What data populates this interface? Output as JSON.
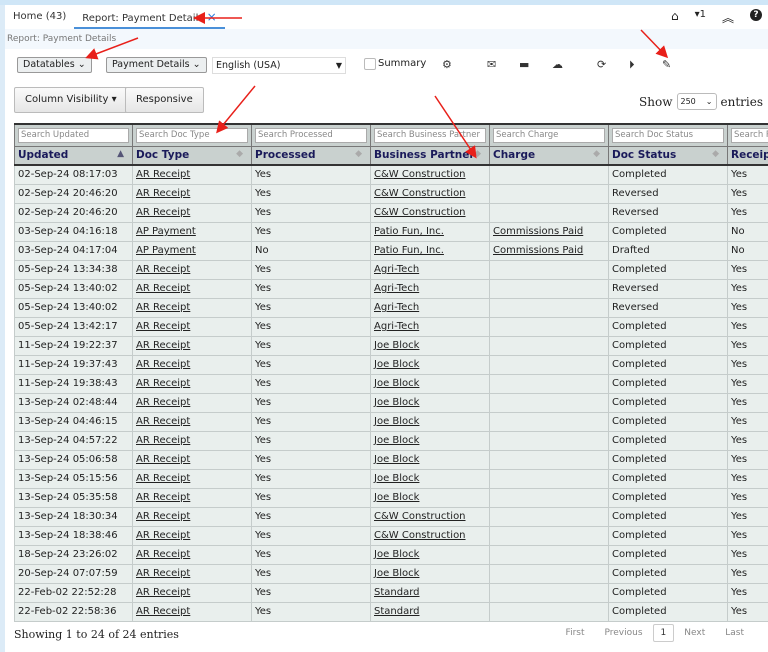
{
  "tabs": [
    {
      "label": "Home (43)"
    },
    {
      "label": "Report: Payment Details",
      "close": "×"
    }
  ],
  "topbar": {
    "icons": [
      "home-icon",
      "caret-down-icon",
      "chevrons-up-icon",
      "help-icon"
    ],
    "notify_count": "1"
  },
  "breadcrumb": "Report: Payment Details",
  "toolbar": {
    "datatables": "Datatables",
    "report": "Payment Details",
    "language": "English (USA)",
    "summary_label": "Summary",
    "summary_checked": false,
    "icons": [
      "gears-icon",
      "envelope-icon",
      "archive-icon",
      "cloud-download-icon",
      "refresh-icon",
      "play-icon",
      "pencil-icon"
    ]
  },
  "buttons": {
    "column_visibility": "Column Visibility",
    "responsive": "Responsive"
  },
  "show": {
    "prefix": "Show",
    "value": "250",
    "suffix": "entries"
  },
  "table": {
    "search_placeholders": [
      "Search Updated",
      "Search Doc Type",
      "Search Processed",
      "Search Business Partner",
      "Search Charge",
      "Search Doc Status",
      "Search Receipt"
    ],
    "columns": [
      "Updated",
      "Doc Type",
      "Processed",
      "Business Partner",
      "Charge",
      "Doc Status",
      "Receipt"
    ],
    "rows": [
      [
        "02-Sep-24 08:17:03",
        "AR Receipt",
        "Yes",
        "C&W Construction",
        "",
        "Completed",
        "Yes"
      ],
      [
        "02-Sep-24 20:46:20",
        "AR Receipt",
        "Yes",
        "C&W Construction",
        "",
        "Reversed",
        "Yes"
      ],
      [
        "02-Sep-24 20:46:20",
        "AR Receipt",
        "Yes",
        "C&W Construction",
        "",
        "Reversed",
        "Yes"
      ],
      [
        "03-Sep-24 04:16:18",
        "AP Payment",
        "Yes",
        "Patio Fun, Inc.",
        "Commissions Paid",
        "Completed",
        "No"
      ],
      [
        "03-Sep-24 04:17:04",
        "AP Payment",
        "No",
        "Patio Fun, Inc.",
        "Commissions Paid",
        "Drafted",
        "No"
      ],
      [
        "05-Sep-24 13:34:38",
        "AR Receipt",
        "Yes",
        "Agri-Tech",
        "",
        "Completed",
        "Yes"
      ],
      [
        "05-Sep-24 13:40:02",
        "AR Receipt",
        "Yes",
        "Agri-Tech",
        "",
        "Reversed",
        "Yes"
      ],
      [
        "05-Sep-24 13:40:02",
        "AR Receipt",
        "Yes",
        "Agri-Tech",
        "",
        "Reversed",
        "Yes"
      ],
      [
        "05-Sep-24 13:42:17",
        "AR Receipt",
        "Yes",
        "Agri-Tech",
        "",
        "Completed",
        "Yes"
      ],
      [
        "11-Sep-24 19:22:37",
        "AR Receipt",
        "Yes",
        "Joe Block",
        "",
        "Completed",
        "Yes"
      ],
      [
        "11-Sep-24 19:37:43",
        "AR Receipt",
        "Yes",
        "Joe Block",
        "",
        "Completed",
        "Yes"
      ],
      [
        "11-Sep-24 19:38:43",
        "AR Receipt",
        "Yes",
        "Joe Block",
        "",
        "Completed",
        "Yes"
      ],
      [
        "13-Sep-24 02:48:44",
        "AR Receipt",
        "Yes",
        "Joe Block",
        "",
        "Completed",
        "Yes"
      ],
      [
        "13-Sep-24 04:46:15",
        "AR Receipt",
        "Yes",
        "Joe Block",
        "",
        "Completed",
        "Yes"
      ],
      [
        "13-Sep-24 04:57:22",
        "AR Receipt",
        "Yes",
        "Joe Block",
        "",
        "Completed",
        "Yes"
      ],
      [
        "13-Sep-24 05:06:58",
        "AR Receipt",
        "Yes",
        "Joe Block",
        "",
        "Completed",
        "Yes"
      ],
      [
        "13-Sep-24 05:15:56",
        "AR Receipt",
        "Yes",
        "Joe Block",
        "",
        "Completed",
        "Yes"
      ],
      [
        "13-Sep-24 05:35:58",
        "AR Receipt",
        "Yes",
        "Joe Block",
        "",
        "Completed",
        "Yes"
      ],
      [
        "13-Sep-24 18:30:34",
        "AR Receipt",
        "Yes",
        "C&W Construction",
        "",
        "Completed",
        "Yes"
      ],
      [
        "13-Sep-24 18:38:46",
        "AR Receipt",
        "Yes",
        "C&W Construction",
        "",
        "Completed",
        "Yes"
      ],
      [
        "18-Sep-24 23:26:02",
        "AR Receipt",
        "Yes",
        "Joe Block",
        "",
        "Completed",
        "Yes"
      ],
      [
        "20-Sep-24 07:07:59",
        "AR Receipt",
        "Yes",
        "Joe Block",
        "",
        "Completed",
        "Yes"
      ],
      [
        "22-Feb-02 22:52:28",
        "AR Receipt",
        "Yes",
        "Standard",
        "",
        "Completed",
        "Yes"
      ],
      [
        "22-Feb-02 22:58:36",
        "AR Receipt",
        "Yes",
        "Standard",
        "",
        "Completed",
        "Yes"
      ]
    ]
  },
  "footer": {
    "info": "Showing 1 to 24 of 24 entries",
    "first": "First",
    "previous": "Previous",
    "page": "1",
    "next": "Next",
    "last": "Last"
  },
  "colors": {
    "header_bg": "#c9d1cf",
    "row_bg": "#e9efed",
    "tab_accent": "#4a90d9",
    "annotation_arrow": "#e8201a"
  }
}
